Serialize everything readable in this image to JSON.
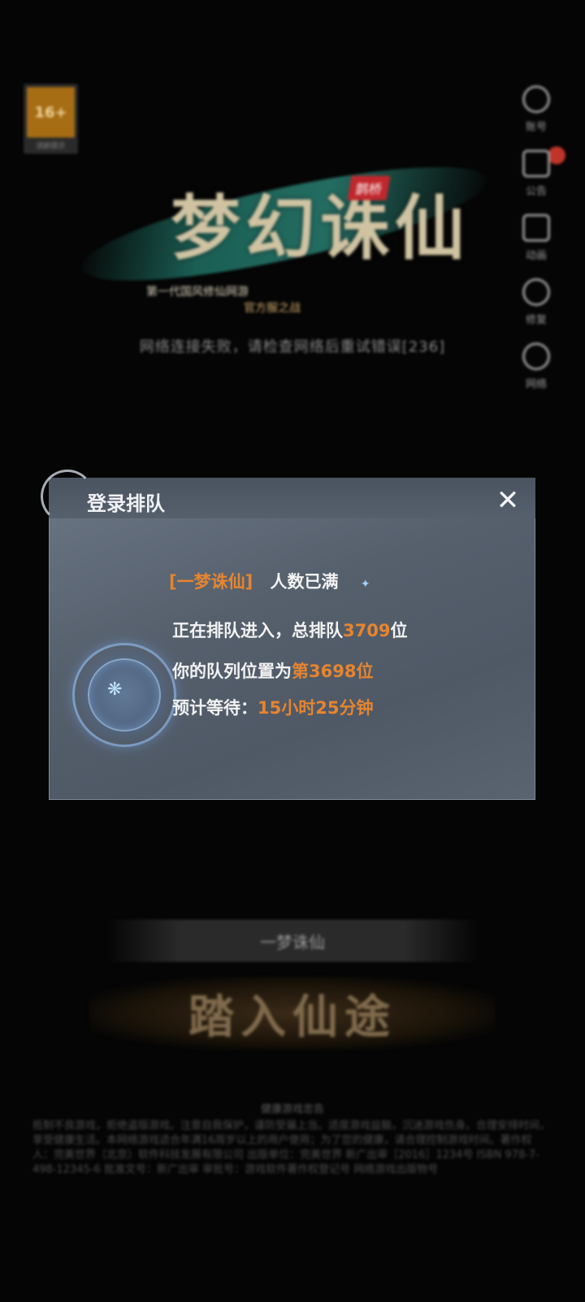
{
  "background": {
    "age_badge": {
      "text": "16+",
      "label": "适龄提示"
    },
    "logo": {
      "title": "梦幻诛仙",
      "badge": "鹊桥",
      "subtitle": "第一代国风修仙网游",
      "subtitle2": "官方服之战"
    },
    "network_message": "网络连接失败，请检查网络后重试错误[236]",
    "side_menu": [
      {
        "icon": "account-icon",
        "label": "账号"
      },
      {
        "icon": "notice-icon",
        "label": "公告"
      },
      {
        "icon": "video-icon",
        "label": "动画"
      },
      {
        "icon": "repair-icon",
        "label": "修复"
      },
      {
        "icon": "network-icon",
        "label": "网络"
      }
    ],
    "server_name": "一梦诛仙",
    "enter_button": "踏入仙途",
    "health_title": "健康游戏忠告",
    "legal_text": "抵制不良游戏，拒绝盗版游戏。注意自我保护，谨防受骗上当。适度游戏益脑，沉迷游戏伤身。合理安排时间，享受健康生活。本网络游戏适合年满16周岁以上的用户使用；为了您的健康，请合理控制游戏时间。著作权人：完美世界（北京）软件科技发展有限公司 出版单位：完美世界 新广出审［2016］1234号 ISBN 978-7-498-12345-6 批准文号：新广出审 审批号：游戏软件著作权登记号 网络游戏出版物号"
  },
  "dialog": {
    "title": "登录排队",
    "server_label": "[一梦诛仙]",
    "status": "人数已满",
    "queue_prefix": "正在排队进入，总排队",
    "queue_total": "3709",
    "queue_suffix": "位",
    "position_prefix": "你的队列位置为",
    "position_value": "第3698位",
    "wait_prefix": "预计等待：",
    "wait_value": "15小时25分钟"
  },
  "colors": {
    "accent_orange": "#e6852f",
    "dialog_bg": "#56606d",
    "notification_dot": "#c0352a"
  }
}
